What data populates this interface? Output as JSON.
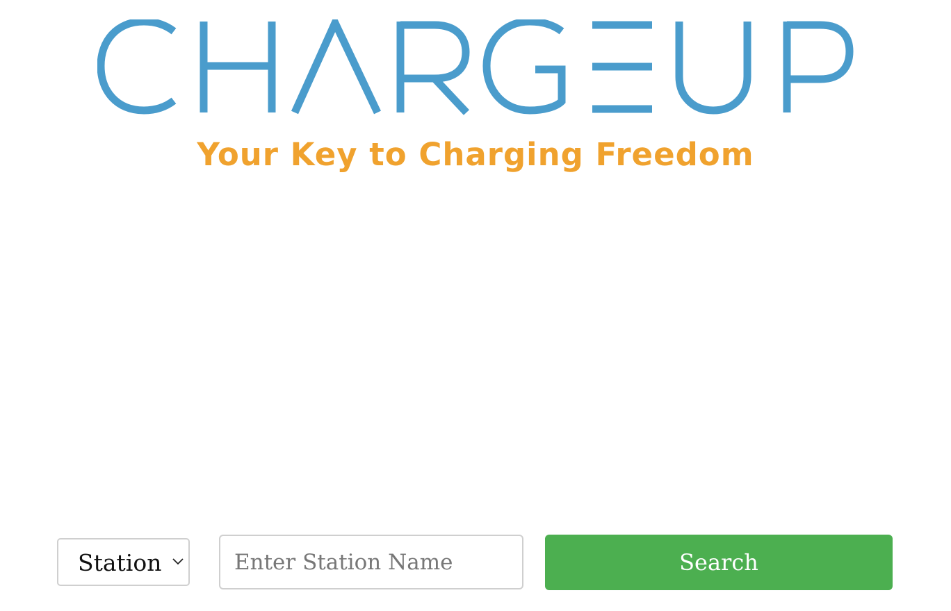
{
  "logo": {
    "wordmark": "CHARGEUP",
    "tagline": "Your Key to Charging Freedom",
    "wordmark_color": "#4a9ccc",
    "tagline_color": "#f0a22e"
  },
  "search": {
    "type_select": {
      "selected": "Station",
      "icon": "chevron-down-icon"
    },
    "input": {
      "value": "",
      "placeholder": "Enter Station Name"
    },
    "button_label": "Search",
    "button_color": "#4caf50"
  }
}
